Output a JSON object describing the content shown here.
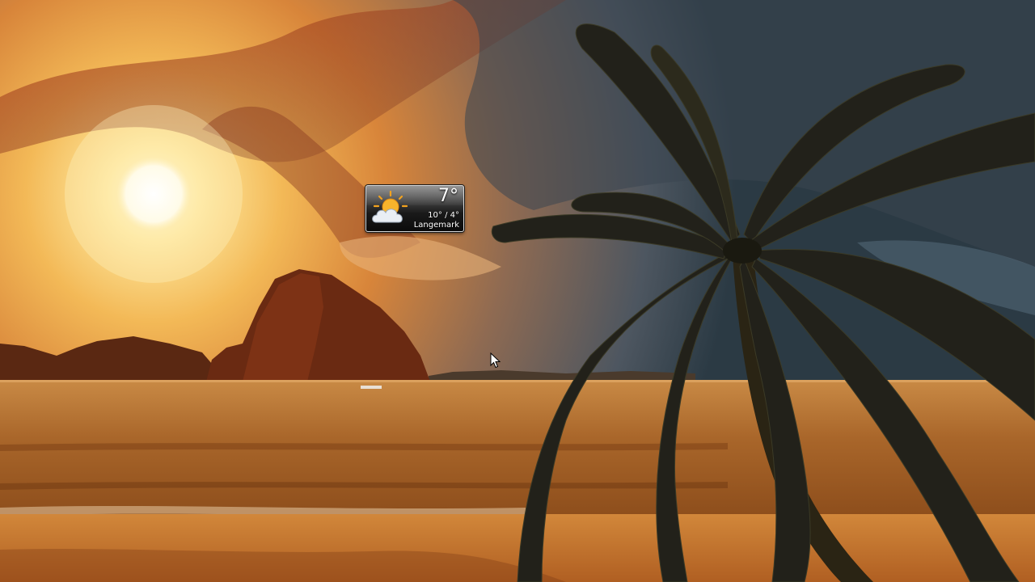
{
  "desktop": {
    "wallpaper": "tropical-beach-sunset"
  },
  "weather_gadget": {
    "icon": "partly-cloudy-icon",
    "temperature": "7°",
    "high_low": "10° / 4°",
    "location": "Langemark"
  },
  "colors": {
    "sky_glow": "#f6c96a",
    "sky_warm": "#c9601e",
    "sky_storm": "#3f4a52",
    "water": "#a8621f",
    "sand": "#c4782e",
    "rock": "#5a2310",
    "palm": "#1f1e12"
  }
}
